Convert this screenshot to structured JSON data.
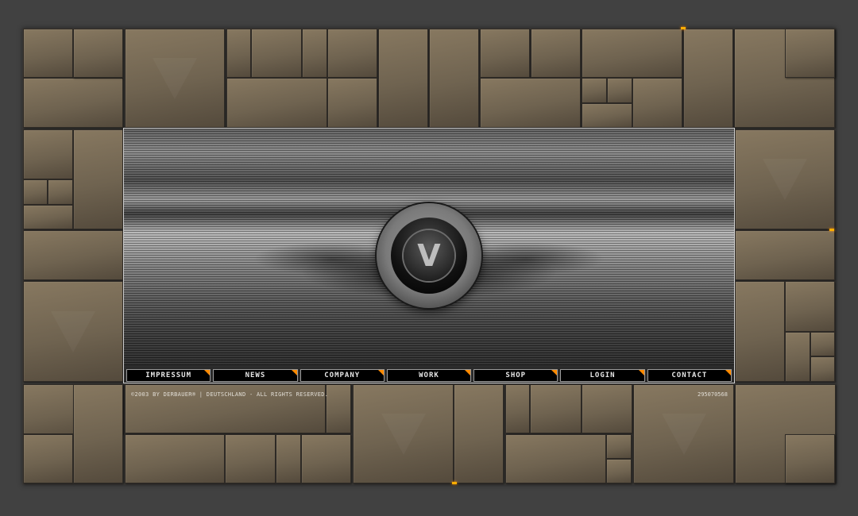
{
  "nav": {
    "items": [
      {
        "label": "IMPRESSUM"
      },
      {
        "label": "NEWS"
      },
      {
        "label": "COMPANY"
      },
      {
        "label": "WORK"
      },
      {
        "label": "SHOP"
      },
      {
        "label": "LOGIN"
      },
      {
        "label": "CONTACT"
      }
    ]
  },
  "logo": {
    "glyph": "V"
  },
  "footer": {
    "copyright": "©2003 BY DERBAUER® | DEUTSCHLAND - ALL RIGHTS RESERVED.",
    "counter": "295070568"
  },
  "colors": {
    "accent": "#ff8a00",
    "background": "#414141",
    "tile": "#7a6c56"
  }
}
